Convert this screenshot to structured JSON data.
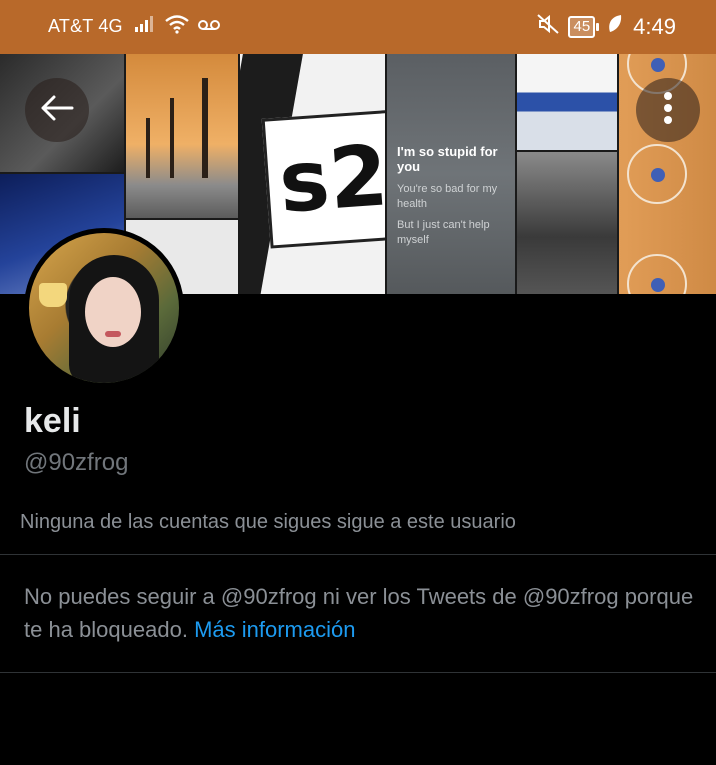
{
  "status_bar": {
    "carrier": "AT&T 4G",
    "battery": "45",
    "time": "4:49",
    "icons": [
      "signal-icon",
      "wifi-icon",
      "voicemail-icon",
      "mute-icon",
      "battery-icon",
      "leaf-icon"
    ]
  },
  "banner": {
    "sign_text": "s2",
    "lyrics_highlight": "I'm so stupid for you",
    "lyrics_lines": [
      "You're so bad for my health",
      "But I just can't help myself"
    ],
    "back_icon": "arrow-left-icon",
    "more_icon": "more-vertical-icon"
  },
  "profile": {
    "name": "keli",
    "handle": "@90zfrog",
    "followers_note": "Ninguna de las cuentas que sigues sigue a este usuario"
  },
  "blocked_notice": {
    "text": "No puedes seguir a @90zfrog ni ver los Tweets de @90zfrog porque te ha bloqueado.",
    "link_label": "Más información"
  },
  "colors": {
    "status_bar": "#b8692a",
    "background": "#000000",
    "link": "#1d9bf0",
    "muted_text": "#71767b"
  }
}
